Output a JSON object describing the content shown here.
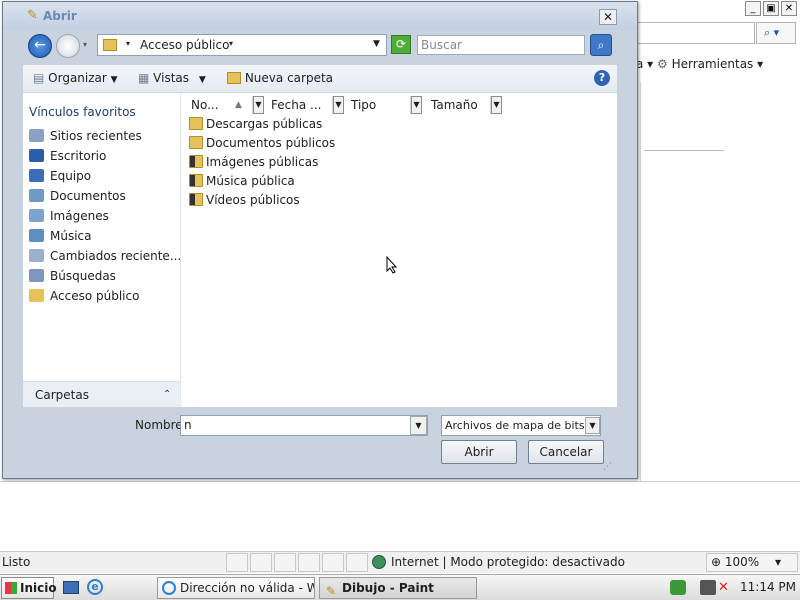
{
  "ie": {
    "cmdbar": {
      "page_label": "ina",
      "tools_label": "Herramientas"
    },
    "status": {
      "left": "Listo",
      "zone": "Internet | Modo protegido: desactivado",
      "zoom": "100%"
    },
    "left_fragment": "P"
  },
  "dialog": {
    "title": "Abrir",
    "address": "Acceso público",
    "search_placeholder": "Buscar",
    "toolbar": {
      "organize": "Organizar",
      "views": "Vistas",
      "new_folder": "Nueva carpeta"
    },
    "favorites_header": "Vínculos favoritos",
    "nav_items": [
      {
        "label": "Sitios recientes",
        "icon": "recent-sites-icon"
      },
      {
        "label": "Escritorio",
        "icon": "desktop-icon"
      },
      {
        "label": "Equipo",
        "icon": "computer-icon"
      },
      {
        "label": "Documentos",
        "icon": "documents-icon"
      },
      {
        "label": "Imágenes",
        "icon": "pictures-icon"
      },
      {
        "label": "Música",
        "icon": "music-icon"
      },
      {
        "label": "Cambiados reciente...",
        "icon": "recently-changed-icon"
      },
      {
        "label": "Búsquedas",
        "icon": "searches-icon"
      },
      {
        "label": "Acceso público",
        "icon": "public-folder-icon"
      }
    ],
    "folders_label": "Carpetas",
    "columns": [
      "No...",
      "Fecha ...",
      "Tipo",
      "Tamaño"
    ],
    "files": [
      "Descargas públicas",
      "Documentos públicos",
      "Imágenes públicas",
      "Música pública",
      "Vídeos públicos"
    ],
    "name_label": "Nombre:",
    "name_value": "n",
    "filter_value": "Archivos de mapa de bits (*.b",
    "open_button": "Abrir",
    "cancel_button": "Cancelar"
  },
  "taskbar": {
    "start": "Inicio",
    "buttons": [
      "Dirección no válida - W...",
      "Dibujo - Paint"
    ],
    "clock": "11:14 PM"
  }
}
